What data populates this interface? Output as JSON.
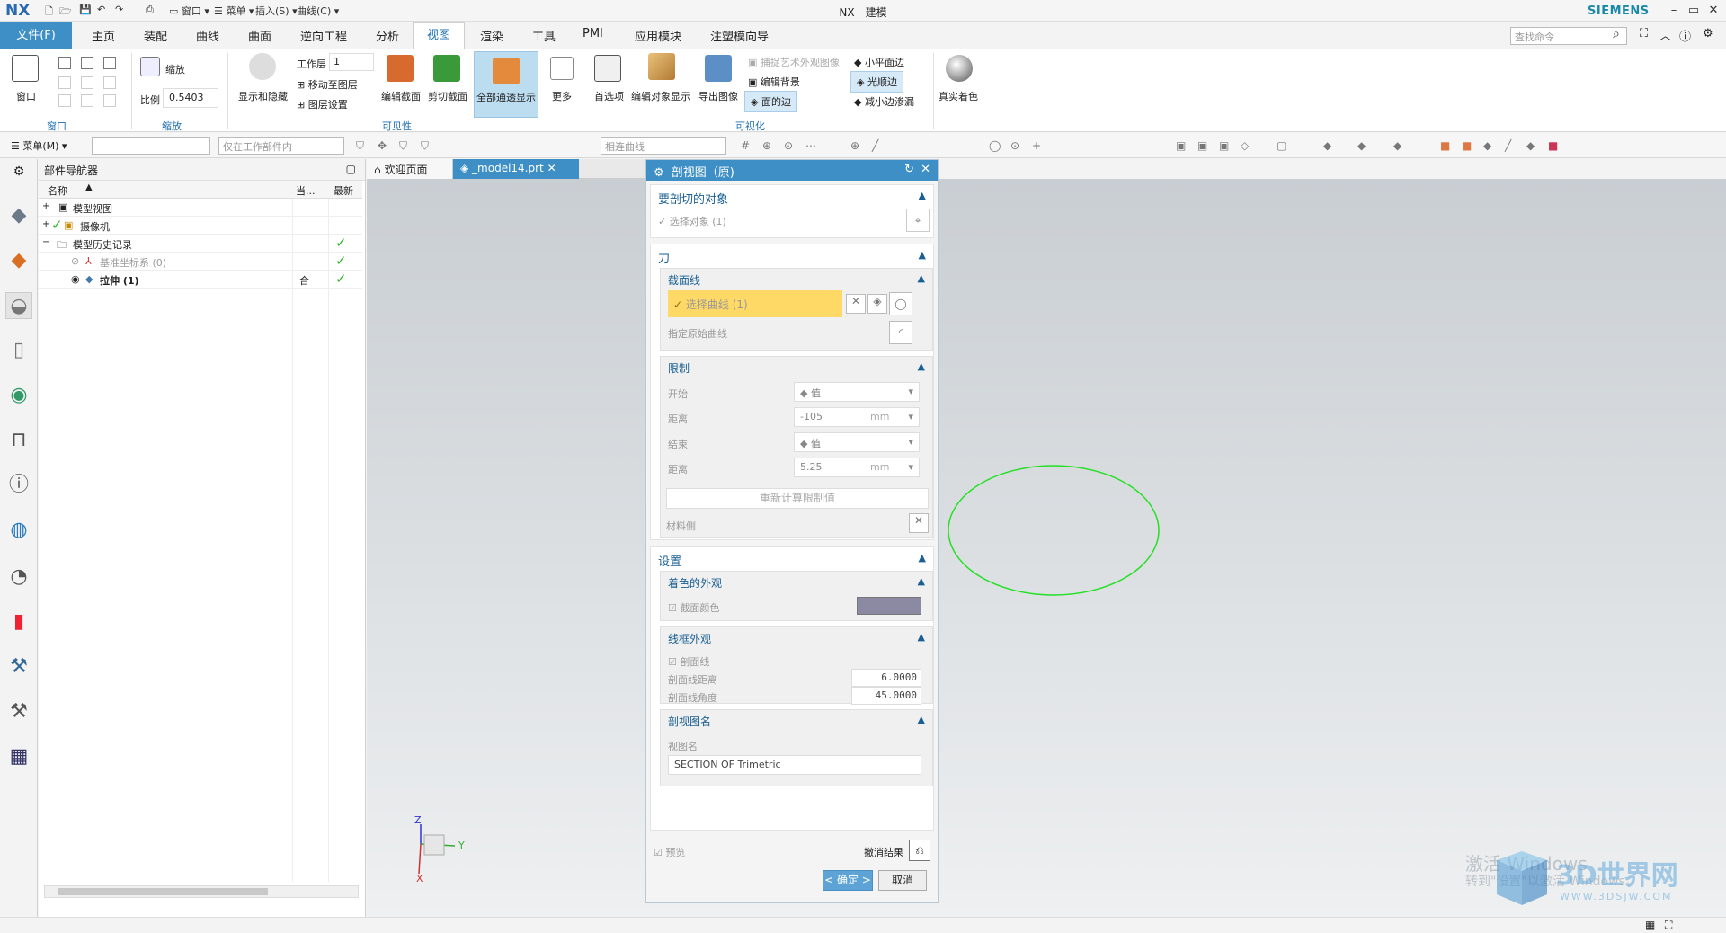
{
  "titlebar": {
    "logo": "NX",
    "window_menu": "窗口",
    "menu": "菜单",
    "insert": "插入(S)",
    "curve": "曲线(C)",
    "title": "NX - 建模",
    "brand": "SIEMENS",
    "min": "–",
    "restore": "▭",
    "close": "✕"
  },
  "menubar": {
    "file": "文件(F)",
    "tabs": [
      "主页",
      "装配",
      "曲线",
      "曲面",
      "逆向工程",
      "分析",
      "视图",
      "渲染",
      "工具",
      "PMI",
      "应用模块",
      "注塑模向导"
    ],
    "active": "视图",
    "search_placeholder": "查找命令"
  },
  "ribbon": {
    "window_btn": "窗口",
    "zoom_label": "缩放",
    "scale_label": "比例",
    "scale_value": "0.5403",
    "showhide": "显示和隐藏",
    "layer_label": "工作层",
    "layer_value": "1",
    "move_layer": "移动至图层",
    "layer_settings": "图层设置",
    "edit_section": "编辑截面",
    "clip_section": "剪切截面",
    "all_transparent": "全部通透显示",
    "more": "更多",
    "prefs": "首选项",
    "edit_obj_display": "编辑对象显示",
    "export_image": "导出图像",
    "art_bg": "捕捉艺术外观图像",
    "edit_bg": "编辑背景",
    "face_edges": "面的边",
    "small_plane_edges": "小平面边",
    "smooth_edges": "光顺边",
    "reduce_edge_leak": "减小边渗漏",
    "true_shading": "真实着色",
    "groups": [
      "窗口",
      "缩放",
      "可见性",
      "可视化"
    ]
  },
  "toolbar2": {
    "menu": "菜单(M)",
    "filter_placeholder": "",
    "scope": "仅在工作部件内",
    "curve_rule": "相连曲线"
  },
  "navigator": {
    "title": "部件导航器",
    "cols": [
      "名称",
      "当...",
      "最新"
    ],
    "rows": [
      {
        "label": "模型视图",
        "indent": 0,
        "check": false,
        "current": ""
      },
      {
        "label": "摄像机",
        "indent": 0,
        "check": false,
        "current": ""
      },
      {
        "label": "模型历史记录",
        "indent": 0,
        "check": true,
        "current": ""
      },
      {
        "label": "基准坐标系 (0)",
        "indent": 1,
        "check": true,
        "current": ""
      },
      {
        "label": "拉伸 (1)",
        "indent": 1,
        "check": true,
        "current": "合"
      }
    ]
  },
  "doctabs": {
    "welcome": "欢迎页面",
    "model": "_model14.prt"
  },
  "dialog": {
    "title": "剖视图（原)",
    "sec_target": "要剖切的对象",
    "select_object": "选择对象 (1)",
    "sec_knife": "刀",
    "sub_section_line": "截面线",
    "select_curve": "选择曲线 (1)",
    "specify_orig_curve": "指定原始曲线",
    "sub_limits": "限制",
    "start": "开始",
    "start_type": "值",
    "dist": "距离",
    "dist1": "-105",
    "unit": "mm",
    "end": "结束",
    "end_type": "值",
    "dist2": "5.25",
    "recalc": "重新计算限制值",
    "material_side": "材料侧",
    "sec_settings": "设置",
    "sub_shaded": "着色的外观",
    "section_color": "截面颜色",
    "section_color_hex": "#8c8aa3",
    "sub_wire": "线框外观",
    "hatch": "剖面线",
    "hatch_dist_label": "剖面线距离",
    "hatch_dist": "6.0000",
    "hatch_angle_label": "剖面线角度",
    "hatch_angle": "45.0000",
    "sub_viewname": "剖视图名",
    "viewname_label": "视图名",
    "viewname": "SECTION OF Trimetric",
    "preview": "预览",
    "undo_result": "撤消结果",
    "ok": "< 确定 >",
    "cancel": "取消"
  },
  "triad": {
    "z": "Z",
    "y": "Y",
    "x": "X"
  },
  "watermark": {
    "line1": "激活 Windows",
    "line2": "转到\"设置\"以激活 Windows。",
    "site": "3D世界网",
    "url": "WWW.3DSJW.COM"
  },
  "colors": {
    "accent": "#3e8fc6",
    "ellipse": "#22e022",
    "highlight": "#ffd966"
  }
}
